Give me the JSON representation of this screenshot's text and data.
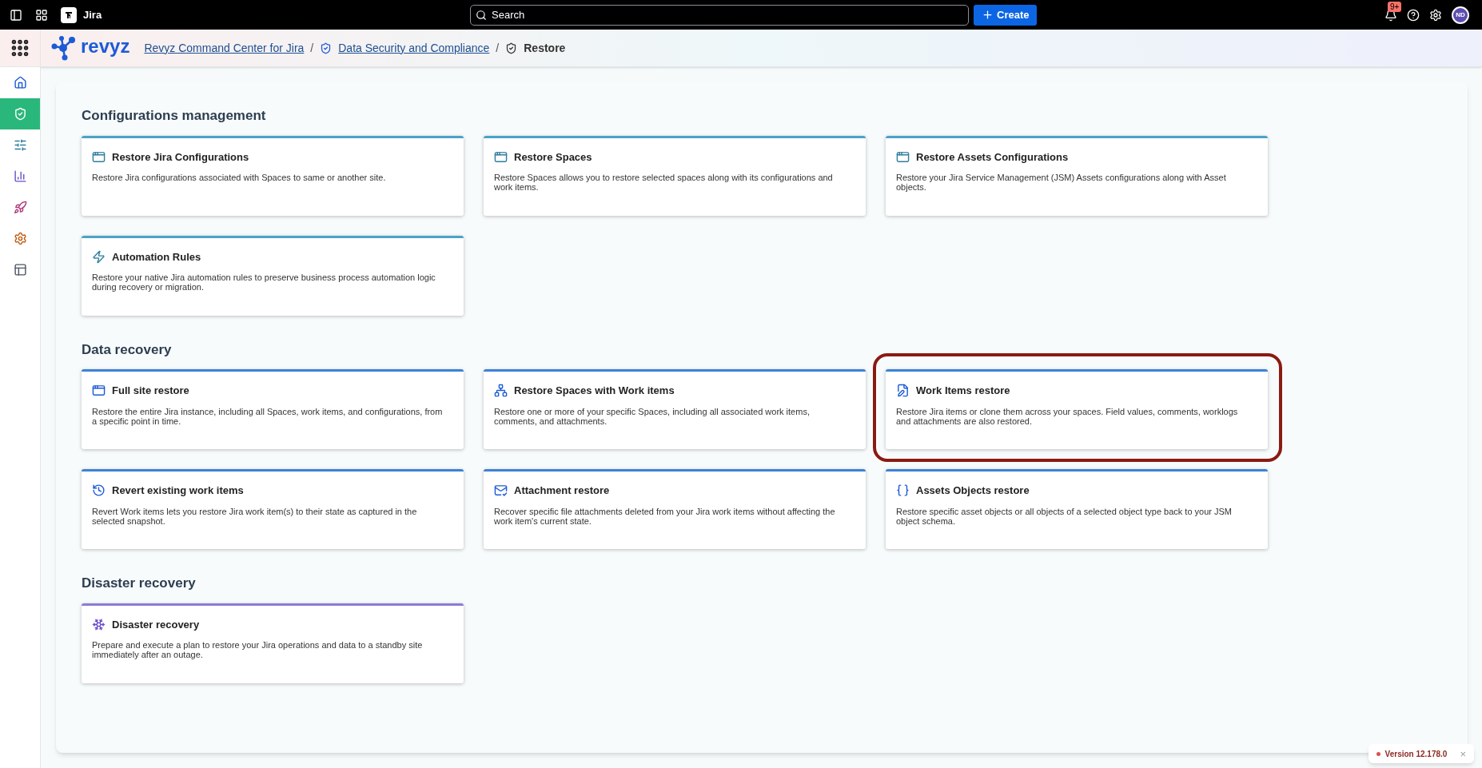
{
  "topbar": {
    "app_name": "Jira",
    "search": {
      "placeholder": "Search"
    },
    "create_label": "Create",
    "notification_count": "9+",
    "avatar_initials": "ND"
  },
  "breadcrumb": {
    "logo_text": "revyz",
    "separator": "/",
    "items": [
      {
        "label": "Revyz Command Center for Jira",
        "kind": "link"
      },
      {
        "label": "Data Security and Compliance",
        "kind": "link"
      },
      {
        "label": "Restore",
        "kind": "current"
      }
    ]
  },
  "sidebar": {
    "items": [
      {
        "selected": false
      },
      {
        "selected": true
      },
      {
        "selected": false
      },
      {
        "selected": false
      },
      {
        "selected": false
      },
      {
        "selected": false
      },
      {
        "selected": false
      }
    ]
  },
  "sections": [
    {
      "title": "Configurations management",
      "color": "#4ba3c7",
      "cards": [
        {
          "title": "Restore Jira Configurations",
          "description": "Restore Jira configurations associated with Spaces to same or another site.",
          "highlighted": false
        },
        {
          "title": "Restore Spaces",
          "description": "Restore Spaces allows you to restore selected spaces along with its configurations and work items.",
          "highlighted": false
        },
        {
          "title": "Restore Assets Configurations",
          "description": "Restore your Jira Service Management (JSM) Assets configurations along with Asset objects.",
          "highlighted": false
        },
        {
          "title": "Automation Rules",
          "description": "Restore your native Jira automation rules to preserve business process automation logic during recovery or migration.",
          "highlighted": false
        }
      ]
    },
    {
      "title": "Data recovery",
      "color": "#3b82d6",
      "cards": [
        {
          "title": "Full site restore",
          "description": "Restore the entire Jira instance, including all Spaces, work items, and configurations, from a specific point in time.",
          "highlighted": false
        },
        {
          "title": "Restore Spaces with Work items",
          "description": "Restore one or more of your specific Spaces, including all associated work items, comments, and attachments.",
          "highlighted": false
        },
        {
          "title": "Work Items restore",
          "description": "Restore Jira items or clone them across your spaces. Field values, comments, worklogs and attachments are also restored.",
          "highlighted": true
        },
        {
          "title": "Revert existing work items",
          "description": "Revert Work items lets you restore Jira work item(s) to their state as captured in the selected snapshot.",
          "highlighted": false
        },
        {
          "title": "Attachment restore",
          "description": "Recover specific file attachments deleted from your Jira work items without affecting the work item's current state.",
          "highlighted": false
        },
        {
          "title": "Assets Objects restore",
          "description": "Restore specific asset objects or all objects of a selected object type back to your JSM object schema.",
          "highlighted": false
        }
      ]
    },
    {
      "title": "Disaster recovery",
      "color": "#8b7ad8",
      "cards": [
        {
          "title": "Disaster recovery",
          "description": "Prepare and execute a plan to restore your Jira operations and data to a standby site immediately after an outage.",
          "highlighted": false
        }
      ]
    }
  ],
  "version_toast": {
    "label": "Version 12.178.0",
    "close": "×"
  }
}
